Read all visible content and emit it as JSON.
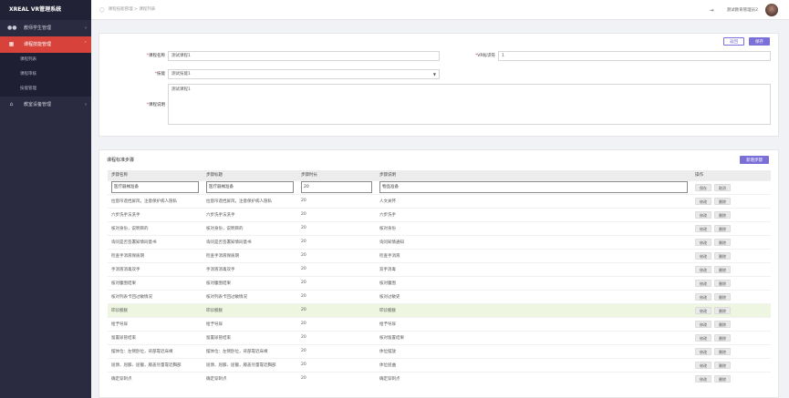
{
  "app": {
    "title": "XREAL VR管理系统"
  },
  "sidebar": {
    "items": [
      {
        "label": "教师学生管理",
        "icon": "users-icon"
      },
      {
        "label": "课程技能管理",
        "icon": "book-icon",
        "active": true,
        "children": [
          {
            "label": "课程列表"
          },
          {
            "label": "课程审核"
          },
          {
            "label": "技能管理"
          }
        ]
      },
      {
        "label": "教室设备管理",
        "icon": "home-icon"
      }
    ]
  },
  "header": {
    "breadcrumb": "课程技能管理 > 课程列表",
    "user": "测试教育管理员2"
  },
  "form": {
    "return_label": "返回",
    "save_label": "保存",
    "course_name_label": "课程名称",
    "course_name_value": "测试课程1",
    "vr_id_label": "VR标识符",
    "vr_id_value": "1",
    "skill_label": "技能",
    "skill_value": "测试技能1",
    "desc_label": "课程说明",
    "desc_value": "测试课程1"
  },
  "steps": {
    "title": "课程标准步骤",
    "add_label": "新增步骤",
    "columns": [
      "步骤名称",
      "步骤标题",
      "步骤时长",
      "步骤说明",
      "操作"
    ],
    "editing_row": {
      "name": "医疗器械准备",
      "title": "医疗器械准备",
      "duration": "20",
      "desc": "物品准备",
      "save": "保存",
      "cancel": "取消"
    },
    "edit_label": "修改",
    "delete_label": "删除",
    "rows": [
      {
        "name": "拉窗帘遮挡屏风，注意保护病人隐私",
        "title": "拉窗帘遮挡屏风，注意保护病人隐私",
        "duration": "20",
        "desc": "人文关怀"
      },
      {
        "name": "六步洗手法洗手",
        "title": "六步洗手法洗手",
        "duration": "20",
        "desc": "六步洗手"
      },
      {
        "name": "核对身份，说明目的",
        "title": "核对身份，说明目的",
        "duration": "20",
        "desc": "核对身份"
      },
      {
        "name": "询问是否签署知情同意书",
        "title": "询问是否签署知情同意书",
        "duration": "20",
        "desc": "询问知情通知"
      },
      {
        "name": "检查手消液保质期",
        "title": "检查手消液保质期",
        "duration": "20",
        "desc": "检查手消液"
      },
      {
        "name": "手消液消毒双手",
        "title": "手消液消毒双手",
        "duration": "20",
        "desc": "双手消毒"
      },
      {
        "name": "核对腹围结果",
        "title": "核对腹围结果",
        "duration": "20",
        "desc": "核对腹围"
      },
      {
        "name": "核对列表卡回过敏情况",
        "title": "核对列表卡回过敏情况",
        "duration": "20",
        "desc": "核对过敏史"
      },
      {
        "name": "叩诊膀胱",
        "title": "叩诊膀胱",
        "duration": "20",
        "desc": "叩诊膀胱",
        "highlight": true
      },
      {
        "name": "给予导尿",
        "title": "给予导尿",
        "duration": "20",
        "desc": "给予导尿"
      },
      {
        "name": "留置尿管结束",
        "title": "留置尿管结束",
        "duration": "20",
        "desc": "核对留置结果"
      },
      {
        "name": "摆体位：左侧卧位，背部靠近床缘",
        "title": "摆体位：左侧卧位，背部靠近床缘",
        "duration": "20",
        "desc": "体位摆放"
      },
      {
        "name": "屈颈、屈膝、屈髋，膝盖尽量靠近胸部",
        "title": "屈颈、屈膝、屈髋，膝盖尽量靠近胸部",
        "duration": "20",
        "desc": "体位屈曲"
      },
      {
        "name": "确定穿刺点",
        "title": "确定穿刺点",
        "duration": "20",
        "desc": "确定穿刺点"
      }
    ]
  }
}
